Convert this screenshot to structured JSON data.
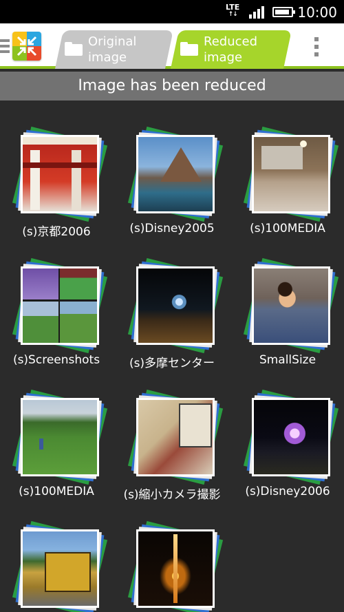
{
  "status_bar": {
    "network": "LTE",
    "network_arrows": "↑↓",
    "time": "10:00",
    "battery_level": 0.9
  },
  "action_bar": {
    "tabs": [
      {
        "label": "Original image",
        "selected": false
      },
      {
        "label": "Reduced image",
        "selected": true
      }
    ],
    "accent_color": "#8dc21f"
  },
  "banner": {
    "text": "Image has been reduced"
  },
  "albums": [
    {
      "name": "(s)京都2006",
      "thumb_icon": "torii-photo"
    },
    {
      "name": "(s)Disney2005",
      "thumb_icon": "volcano-photo"
    },
    {
      "name": "(s)100MEDIA",
      "thumb_icon": "room-photo"
    },
    {
      "name": "(s)Screenshots",
      "thumb_icon": "screenshots-collage"
    },
    {
      "name": "(s)多摩センター",
      "thumb_icon": "night-illumination-photo"
    },
    {
      "name": "SmallSize",
      "thumb_icon": "child-photo"
    },
    {
      "name": "(s)100MEDIA",
      "thumb_icon": "park-photo"
    },
    {
      "name": "(s)縮小カメラ撮影",
      "thumb_icon": "book-photo"
    },
    {
      "name": "(s)Disney2006",
      "thumb_icon": "castle-photo"
    },
    {
      "name": "",
      "thumb_icon": "bus-photo"
    },
    {
      "name": "",
      "thumb_icon": "tower-photo"
    }
  ]
}
